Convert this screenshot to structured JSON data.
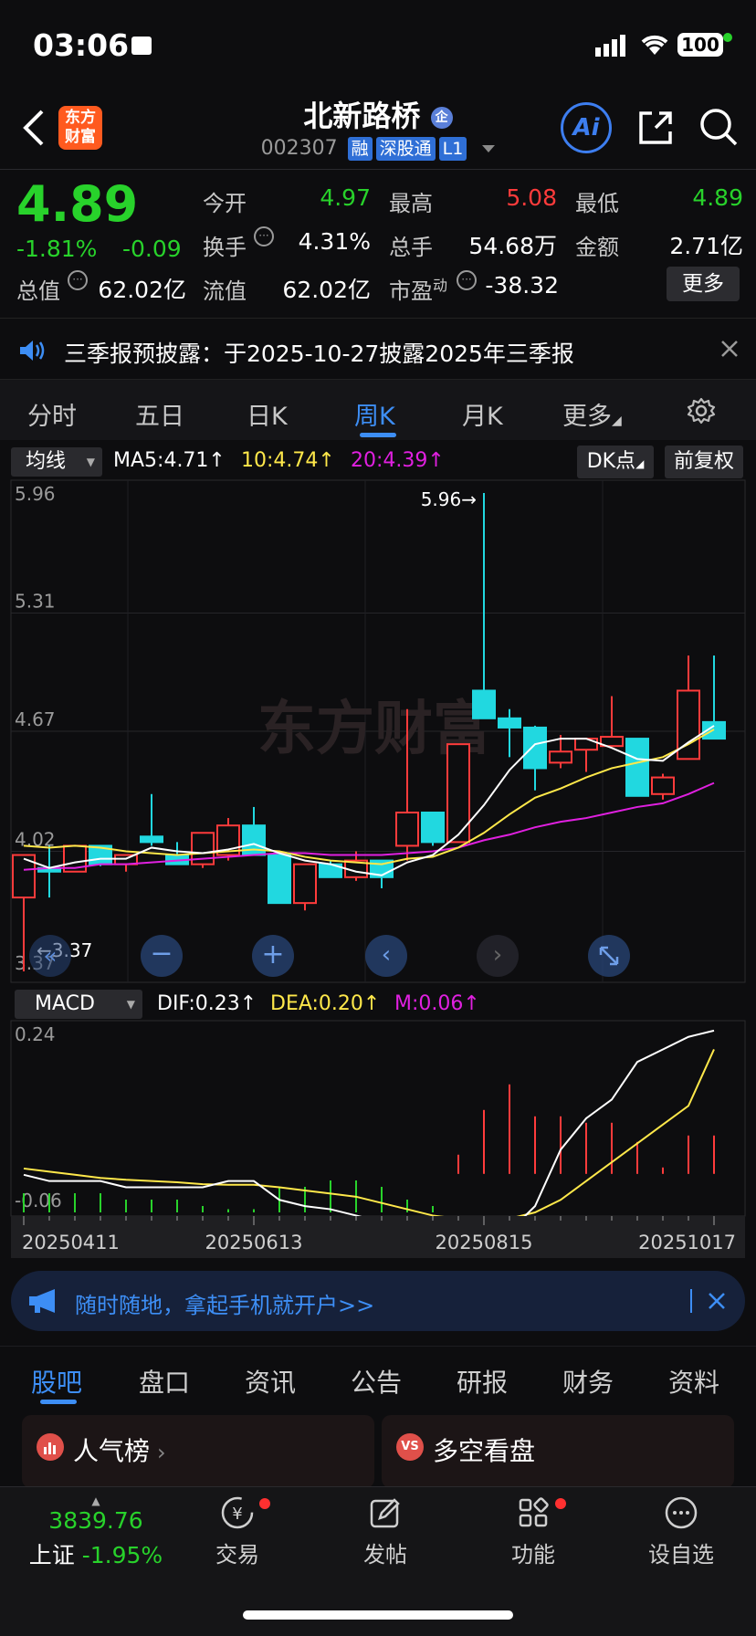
{
  "status": {
    "time": "03:06",
    "battery": "100"
  },
  "header": {
    "logo_text": "东方\n财富",
    "stock_name": "北新路桥",
    "name_badge": "企",
    "code": "002307",
    "tags": [
      "融",
      "深股通",
      "L1"
    ],
    "ai_label": "Ai"
  },
  "quote": {
    "price": "4.89",
    "change_pct": "-1.81%",
    "change_abs": "-0.09",
    "rows": [
      [
        {
          "label": "今开",
          "value": "4.97",
          "color": "green"
        },
        {
          "label": "最高",
          "value": "5.08",
          "color": "red"
        },
        {
          "label": "最低",
          "value": "4.89",
          "color": "green"
        }
      ],
      [
        {
          "label": "换手",
          "value": "4.31%",
          "color": "white"
        },
        {
          "label": "总手",
          "value": "54.68万",
          "color": "white"
        },
        {
          "label": "金额",
          "value": "2.71亿",
          "color": "white"
        }
      ]
    ],
    "total_value_label": "总值",
    "total_value": "62.02亿",
    "float_label": "流值",
    "float_value": "62.02亿",
    "pe_label": "市盈",
    "pe_sup": "动",
    "pe_value": "-38.32",
    "more_label": "更多"
  },
  "notice": {
    "text": "三季报预披露：于2025-10-27披露2025年三季报"
  },
  "chart_tabs": [
    "分时",
    "五日",
    "日K",
    "周K",
    "月K",
    "更多"
  ],
  "active_chart_tab": "周K",
  "legend": {
    "ma_select": "均线",
    "ma5": "MA5:4.71↑",
    "ma10": "10:4.74↑",
    "ma20": "20:4.39↑",
    "dk_label": "DK点",
    "adjust_label": "前复权"
  },
  "macd_legend": {
    "select": "MACD",
    "dif": "DIF:0.23↑",
    "dea": "DEA:0.20↑",
    "m": "M:0.06↑"
  },
  "colors": {
    "up": "#ff3b3b",
    "down": "#21d8e0",
    "ma5": "#ffffff",
    "ma10": "#ffe84a",
    "ma20": "#e020e0",
    "accent": "#3d8ef5"
  },
  "chart_data": [
    {
      "type": "candlestick",
      "y_ticks": [
        "5.96",
        "5.31",
        "4.67",
        "4.02",
        "3.37"
      ],
      "ylim": [
        3.37,
        5.96
      ],
      "high_annotation": "5.96→",
      "low_annotation": "3.37",
      "watermark": "东方财富",
      "candles": [
        {
          "o": 3.77,
          "h": 4.0,
          "l": 3.37,
          "c": 4.0
        },
        {
          "o": 3.93,
          "h": 4.05,
          "l": 3.77,
          "c": 3.91
        },
        {
          "o": 3.91,
          "h": 4.05,
          "l": 3.91,
          "c": 4.05
        },
        {
          "o": 4.05,
          "h": 4.05,
          "l": 3.94,
          "c": 3.95
        },
        {
          "o": 3.95,
          "h": 4.0,
          "l": 3.91,
          "c": 4.0
        },
        {
          "o": 4.1,
          "h": 4.33,
          "l": 4.05,
          "c": 4.07
        },
        {
          "o": 4.0,
          "h": 4.07,
          "l": 3.95,
          "c": 3.95
        },
        {
          "o": 3.95,
          "h": 4.12,
          "l": 3.93,
          "c": 4.12
        },
        {
          "o": 4.0,
          "h": 4.2,
          "l": 3.97,
          "c": 4.16
        },
        {
          "o": 4.16,
          "h": 4.26,
          "l": 4.0,
          "c": 4.0
        },
        {
          "o": 4.0,
          "h": 4.0,
          "l": 3.74,
          "c": 3.74
        },
        {
          "o": 3.74,
          "h": 3.95,
          "l": 3.7,
          "c": 3.95
        },
        {
          "o": 3.95,
          "h": 3.97,
          "l": 3.88,
          "c": 3.88
        },
        {
          "o": 3.88,
          "h": 4.02,
          "l": 3.86,
          "c": 3.97
        },
        {
          "o": 3.97,
          "h": 3.97,
          "l": 3.82,
          "c": 3.88
        },
        {
          "o": 4.05,
          "h": 4.79,
          "l": 3.97,
          "c": 4.23
        },
        {
          "o": 4.23,
          "h": 4.23,
          "l": 4.05,
          "c": 4.07
        },
        {
          "o": 4.07,
          "h": 4.6,
          "l": 4.07,
          "c": 4.6
        },
        {
          "o": 4.89,
          "h": 5.96,
          "l": 4.74,
          "c": 4.74
        },
        {
          "o": 4.74,
          "h": 4.79,
          "l": 4.53,
          "c": 4.69
        },
        {
          "o": 4.69,
          "h": 4.7,
          "l": 4.35,
          "c": 4.47
        },
        {
          "o": 4.5,
          "h": 4.65,
          "l": 4.47,
          "c": 4.56
        },
        {
          "o": 4.57,
          "h": 4.63,
          "l": 4.45,
          "c": 4.63
        },
        {
          "o": 4.59,
          "h": 4.86,
          "l": 4.59,
          "c": 4.64
        },
        {
          "o": 4.63,
          "h": 4.63,
          "l": 4.32,
          "c": 4.32
        },
        {
          "o": 4.33,
          "h": 4.44,
          "l": 4.3,
          "c": 4.42
        },
        {
          "o": 4.52,
          "h": 5.08,
          "l": 4.52,
          "c": 4.89
        },
        {
          "o": 4.72,
          "h": 5.08,
          "l": 4.72,
          "c": 4.63
        }
      ],
      "ma5": [
        3.98,
        3.93,
        3.96,
        3.98,
        3.98,
        4.04,
        4.02,
        4.01,
        4.03,
        4.06,
        4.01,
        3.97,
        3.95,
        3.91,
        3.89,
        3.96,
        4.0,
        4.11,
        4.27,
        4.46,
        4.6,
        4.63,
        4.63,
        4.58,
        4.52,
        4.51,
        4.61,
        4.7
      ],
      "ma10": [
        4.05,
        4.04,
        4.05,
        4.04,
        4.02,
        4.01,
        4.0,
        4.01,
        4.02,
        4.03,
        4.02,
        3.99,
        3.97,
        3.96,
        3.95,
        3.98,
        3.99,
        4.04,
        4.12,
        4.22,
        4.31,
        4.36,
        4.42,
        4.47,
        4.5,
        4.53,
        4.6,
        4.68
      ],
      "ma20": [
        3.92,
        3.93,
        3.93,
        3.95,
        3.95,
        3.96,
        3.97,
        3.98,
        3.99,
        4.0,
        4.01,
        4.01,
        4.0,
        4.0,
        4.0,
        4.01,
        4.02,
        4.04,
        4.08,
        4.11,
        4.15,
        4.18,
        4.2,
        4.23,
        4.26,
        4.28,
        4.33,
        4.39
      ]
    },
    {
      "type": "macd",
      "y_ticks": [
        "0.24",
        "-0.06"
      ],
      "ylim": [
        -0.06,
        0.24
      ],
      "x_ticks": [
        "20250411",
        "20250613",
        "20250815",
        "20251017"
      ],
      "dif": [
        0.0,
        -0.01,
        -0.01,
        -0.01,
        -0.02,
        -0.02,
        -0.02,
        -0.02,
        -0.01,
        -0.01,
        -0.04,
        -0.05,
        -0.055,
        -0.065,
        -0.075,
        -0.095,
        -0.1,
        -0.11,
        -0.09,
        -0.09,
        -0.05,
        0.04,
        0.09,
        0.12,
        0.18,
        0.2,
        0.22,
        0.23
      ],
      "dea": [
        0.01,
        0.005,
        0.0,
        -0.005,
        -0.008,
        -0.01,
        -0.012,
        -0.015,
        -0.016,
        -0.016,
        -0.02,
        -0.025,
        -0.03,
        -0.035,
        -0.045,
        -0.055,
        -0.065,
        -0.07,
        -0.07,
        -0.07,
        -0.06,
        -0.04,
        -0.01,
        0.02,
        0.05,
        0.08,
        0.11,
        0.2
      ],
      "hist": [
        -0.03,
        -0.03,
        -0.03,
        -0.03,
        -0.02,
        -0.02,
        -0.02,
        -0.01,
        -0.005,
        -0.005,
        -0.04,
        -0.04,
        -0.05,
        -0.05,
        -0.04,
        -0.02,
        -0.01,
        0.03,
        0.1,
        0.14,
        0.09,
        0.09,
        0.08,
        0.08,
        0.05,
        0.01,
        0.06,
        0.06
      ]
    }
  ],
  "ad_bar": {
    "text": "随时随地，拿起手机就开户>>"
  },
  "news_tabs": [
    "股吧",
    "盘口",
    "资讯",
    "公告",
    "研报",
    "财务",
    "资料"
  ],
  "active_news_tab": "股吧",
  "cards": [
    {
      "title": "人气榜"
    },
    {
      "title": "多空看盘"
    }
  ],
  "bottom_nav": {
    "index_value": "3839.76",
    "index_name": "上证",
    "index_change": "-1.95%",
    "items": [
      "交易",
      "发帖",
      "功能",
      "设自选"
    ]
  }
}
